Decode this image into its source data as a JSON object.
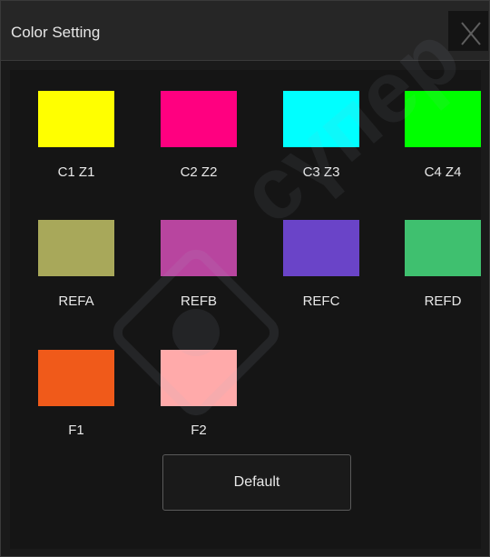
{
  "dialog": {
    "title": "Color Setting",
    "close_icon": "close-icon",
    "default_label": "Default"
  },
  "swatches": [
    {
      "label": "C1 Z1",
      "color": "#ffff00"
    },
    {
      "label": "C2 Z2",
      "color": "#ff0080"
    },
    {
      "label": "C3 Z3",
      "color": "#00ffff"
    },
    {
      "label": "C4 Z4",
      "color": "#00ff00"
    },
    {
      "label": "REFA",
      "color": "#a8a85a"
    },
    {
      "label": "REFB",
      "color": "#b8459f"
    },
    {
      "label": "REFC",
      "color": "#6a44c8"
    },
    {
      "label": "REFD",
      "color": "#3fc06f"
    },
    {
      "label": "F1",
      "color": "#f05a1a"
    },
    {
      "label": "F2",
      "color": "#ffaaaa"
    }
  ],
  "watermark": {
    "text": "сүпер"
  }
}
